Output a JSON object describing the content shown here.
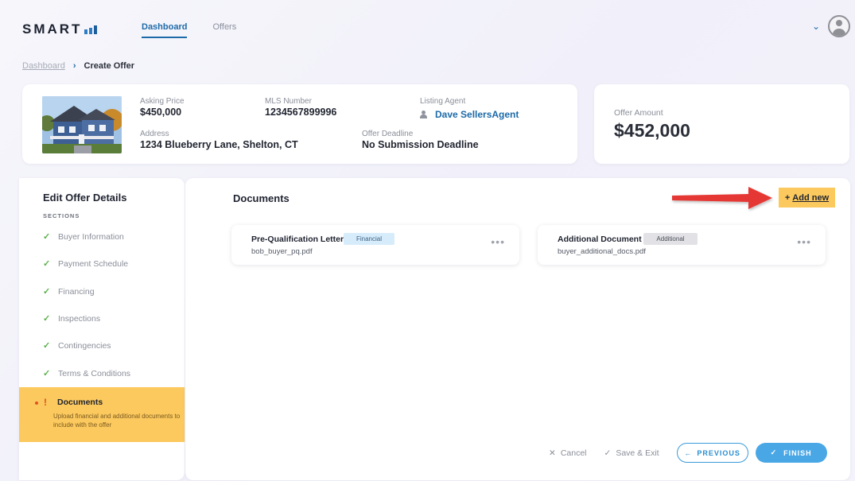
{
  "header": {
    "logo": "SMART",
    "nav": [
      {
        "label": "Dashboard",
        "active": true
      },
      {
        "label": "Offers",
        "active": false
      }
    ]
  },
  "breadcrumb": {
    "parent": "Dashboard",
    "current": "Create Offer"
  },
  "property": {
    "asking_price_label": "Asking Price",
    "asking_price": "$450,000",
    "mls_label": "MLS Number",
    "mls": "1234567899996",
    "agent_label": "Listing Agent",
    "agent": "Dave SellersAgent",
    "address_label": "Address",
    "address": "1234 Blueberry Lane, Shelton, CT",
    "deadline_label": "Offer Deadline",
    "deadline": "No Submission Deadline"
  },
  "offer": {
    "label": "Offer Amount",
    "amount": "$452,000"
  },
  "sidebar": {
    "title": "Edit Offer Details",
    "sections_label": "SECTIONS",
    "items": [
      {
        "label": "Buyer Information"
      },
      {
        "label": "Payment Schedule"
      },
      {
        "label": "Financing"
      },
      {
        "label": "Inspections"
      },
      {
        "label": "Contingencies"
      },
      {
        "label": "Terms & Conditions"
      }
    ],
    "active": {
      "label": "Documents",
      "description": "Upload financial and additional documents to include with the offer"
    }
  },
  "documents": {
    "title": "Documents",
    "add_new": "Add new",
    "items": [
      {
        "name": "Pre-Qualification Letter",
        "tag": "Financial",
        "file": "bob_buyer_pq.pdf"
      },
      {
        "name": "Additional Document",
        "tag": "Additional",
        "file": "buyer_additional_docs.pdf"
      }
    ]
  },
  "actions": {
    "cancel": "Cancel",
    "save_exit": "Save & Exit",
    "previous": "PREVIOUS",
    "finish": "FINISH"
  },
  "colors": {
    "accent": "#1d6aa8",
    "highlight": "#fcc95e",
    "check": "#5ab14b",
    "primary_button": "#4aa7e6",
    "annotation_arrow": "#e53935"
  }
}
